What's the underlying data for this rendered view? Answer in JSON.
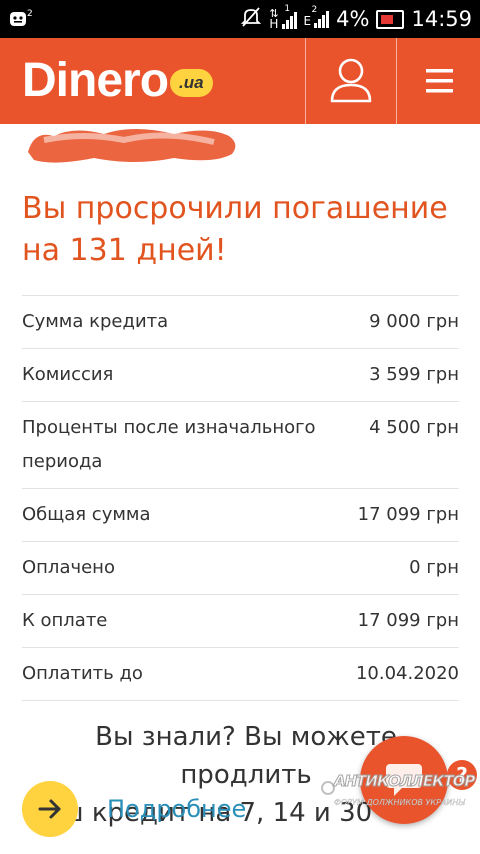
{
  "status_bar": {
    "left_icon": "notification-icon",
    "mute_icon": "mute-icon",
    "sim1_network": "H",
    "sim1_slot": "1",
    "sim2_network": "E",
    "sim2_slot": "2",
    "battery_percent": "4%",
    "battery_level": 0.04,
    "time": "14:59"
  },
  "header": {
    "logo_text": "Dinero",
    "logo_tld": ".ua",
    "profile_icon": "user-icon",
    "menu_icon": "hamburger-menu-icon",
    "background_color": "#e9542c",
    "tld_badge_color": "#ffd23f"
  },
  "account": {
    "name_redacted": true
  },
  "alert": {
    "overdue_text": "Вы просрочили погашение на 131 дней!",
    "accent_color": "#e1541f"
  },
  "loan_table": {
    "rows": [
      {
        "label": "Сумма кредита",
        "value": "9 000 грн"
      },
      {
        "label": "Комиссия",
        "value": "3 599 грн"
      },
      {
        "label": "Проценты после изначального периода",
        "value": "4 500 грн"
      },
      {
        "label": "Общая сумма",
        "value": "17 099 грн"
      },
      {
        "label": "Оплачено",
        "value": "0 грн"
      },
      {
        "label": "К оплате",
        "value": "17 099 грн"
      },
      {
        "label": "Оплатить до",
        "value": "10.04.2020"
      }
    ]
  },
  "promo": {
    "line1": "Вы знали? Вы можете продлить",
    "line2": "Ваш кредит на 7, 14 и 30"
  },
  "more": {
    "label": "Подробнее",
    "icon": "arrow-right-icon",
    "link_color": "#2a8fb8"
  },
  "chat": {
    "icon": "chat-icon",
    "help_badge": "?"
  },
  "watermark": {
    "line1": "АНТИКОЛЛЕКТОР",
    "line2": "ФОРУМ ДОЛЖНИКОВ УКРАИНЫ"
  }
}
